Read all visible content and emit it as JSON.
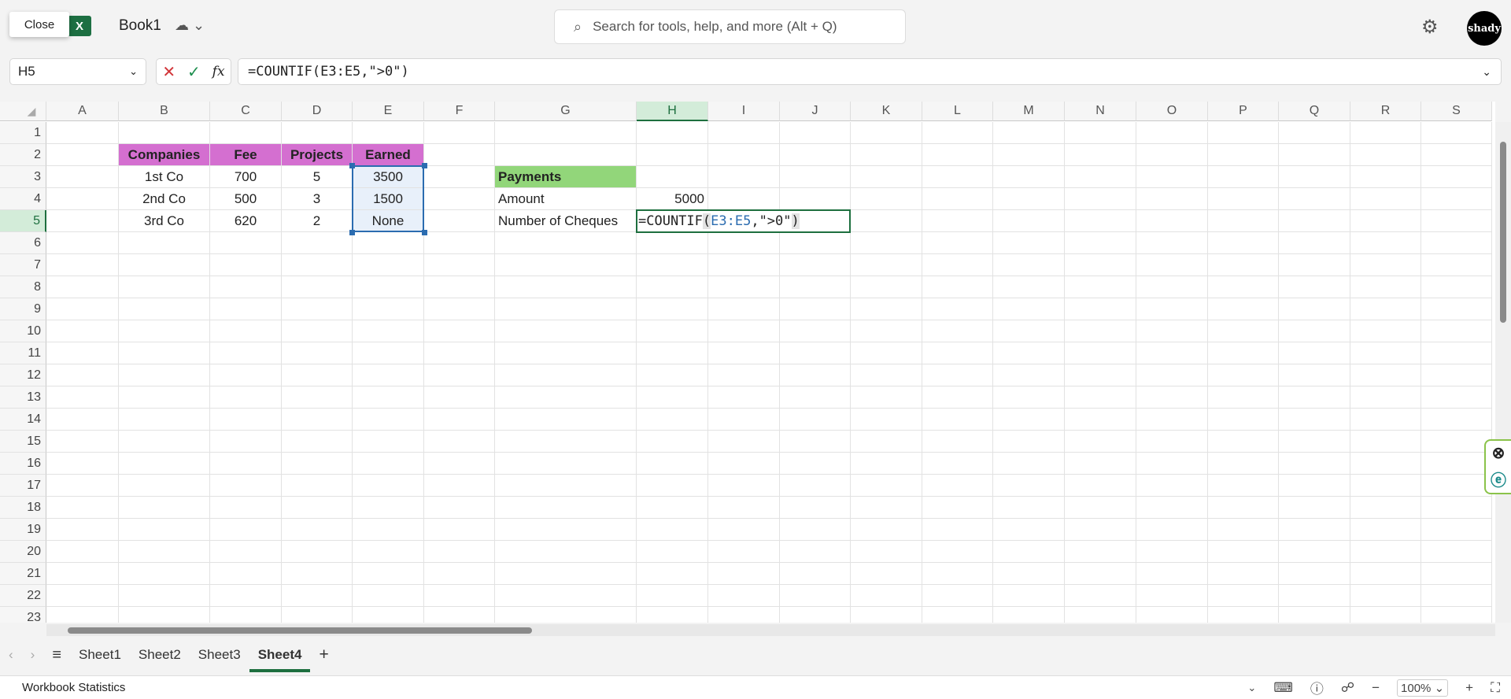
{
  "app": {
    "close_label": "Close",
    "icon_letter": "X",
    "title": "Book1",
    "cloud_icon": "cloud-saved-icon",
    "avatar_text": "shady"
  },
  "search": {
    "placeholder": "Search for tools, help, and more (Alt + Q)"
  },
  "formula_bar": {
    "name_box": "H5",
    "cancel": "✕",
    "enter": "✓",
    "fx": "fx",
    "formula": "=COUNTIF(E3:E5,\">0\")"
  },
  "columns": [
    "A",
    "B",
    "C",
    "D",
    "E",
    "F",
    "G",
    "H",
    "I",
    "J",
    "K",
    "L",
    "M",
    "N",
    "O",
    "P",
    "Q",
    "R",
    "S"
  ],
  "rows": [
    "1",
    "2",
    "3",
    "4",
    "5",
    "6",
    "7",
    "8",
    "9",
    "10",
    "11",
    "12",
    "13",
    "14",
    "15",
    "16",
    "17",
    "18",
    "19",
    "20",
    "21",
    "22",
    "23"
  ],
  "active_cell": "H5",
  "cells": {
    "B2": "Companies",
    "C2": "Fee",
    "D2": "Projects",
    "E2": "Earned",
    "B3": "1st Co",
    "C3": "700",
    "D3": "5",
    "E3": "3500",
    "B4": "2nd Co",
    "C4": "500",
    "D4": "3",
    "E4": "1500",
    "B5": "3rd Co",
    "C5": "620",
    "D5": "2",
    "E5": "None",
    "G3": "Payments",
    "G4": "Amount",
    "H4": "5000",
    "G5": "Number of Cheques"
  },
  "edit": {
    "prefix": "=COUNTIF",
    "open": "(",
    "ref": "E3:E5",
    "mid": ",\">0\"",
    "close": ")"
  },
  "colors": {
    "header_fill": "#d46fd0",
    "payments_fill": "#92d67a",
    "selection": "#2b6cb0",
    "accent": "#1e6f3f"
  },
  "sheets": {
    "tabs": [
      "Sheet1",
      "Sheet2",
      "Sheet3",
      "Sheet4"
    ],
    "active": "Sheet4",
    "add": "+"
  },
  "status": {
    "left": "Workbook Statistics",
    "zoom": "100%"
  }
}
